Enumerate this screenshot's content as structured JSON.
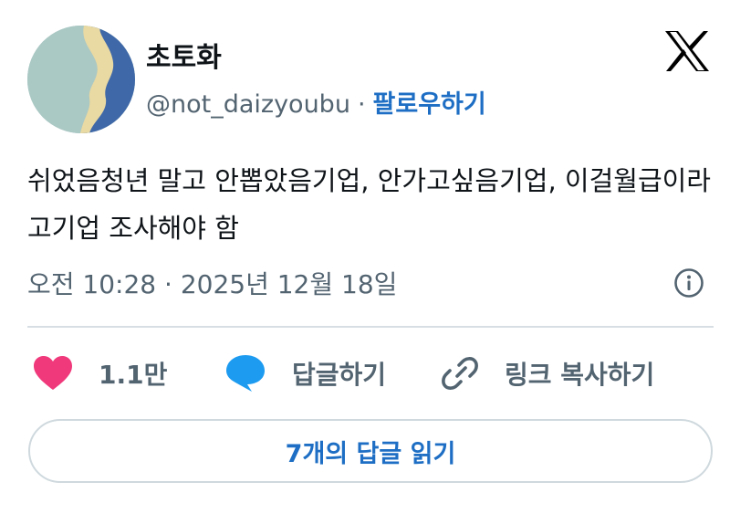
{
  "author": {
    "display_name": "초토화",
    "handle": "@not_daizyoubu",
    "separator": "·",
    "follow_label": "팔로우하기"
  },
  "tweet": {
    "text": "쉬었음청년 말고 안뽑았음기업, 안가고싶음기업, 이걸월급이라고기업 조사해야 함",
    "timestamp": "오전 10:28 · 2025년 12월 18일"
  },
  "actions": {
    "like_count": "1.1만",
    "reply_label": "답글하기",
    "copy_link_label": "링크 복사하기"
  },
  "read_replies_label": "7개의 답글 읽기",
  "icons": {
    "logo": "x-logo-icon",
    "info": "info-icon",
    "like": "heart-icon",
    "reply": "speech-bubble-icon",
    "copy": "link-icon"
  },
  "colors": {
    "like": "#f0397b",
    "reply": "#1d9bf0",
    "link_text": "#1d6ec4",
    "muted": "#536471"
  }
}
